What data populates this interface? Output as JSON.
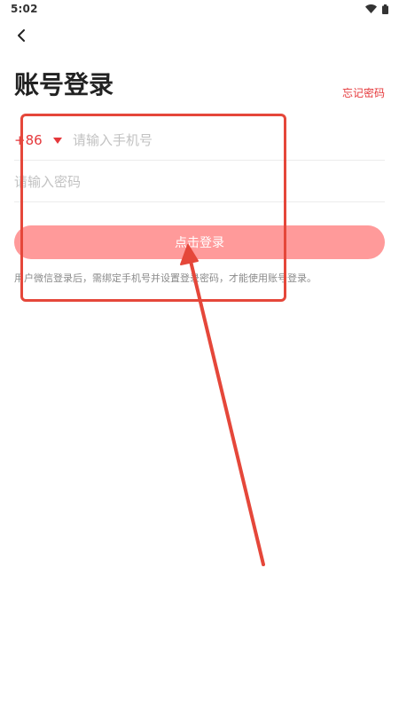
{
  "status_bar": {
    "time": "5:02",
    "icons": [
      "wifi-icon",
      "battery-icon"
    ]
  },
  "header": {
    "back_icon": "chevron-left-icon",
    "title": "账号登录",
    "forgot_password": "忘记密码"
  },
  "form": {
    "country_code": "+86",
    "country_dropdown_icon": "triangle-down-icon",
    "phone_placeholder": "请输入手机号",
    "phone_value": "",
    "password_placeholder": "请输入密码",
    "password_value": ""
  },
  "login_button": {
    "label": "点击登录"
  },
  "hint": "用户微信登录后，需绑定手机号并设置登录密码，才能使用账号登录。",
  "colors": {
    "accent": "#e5383b",
    "button": "#ff9a9a",
    "annotation": "#e5473a"
  }
}
